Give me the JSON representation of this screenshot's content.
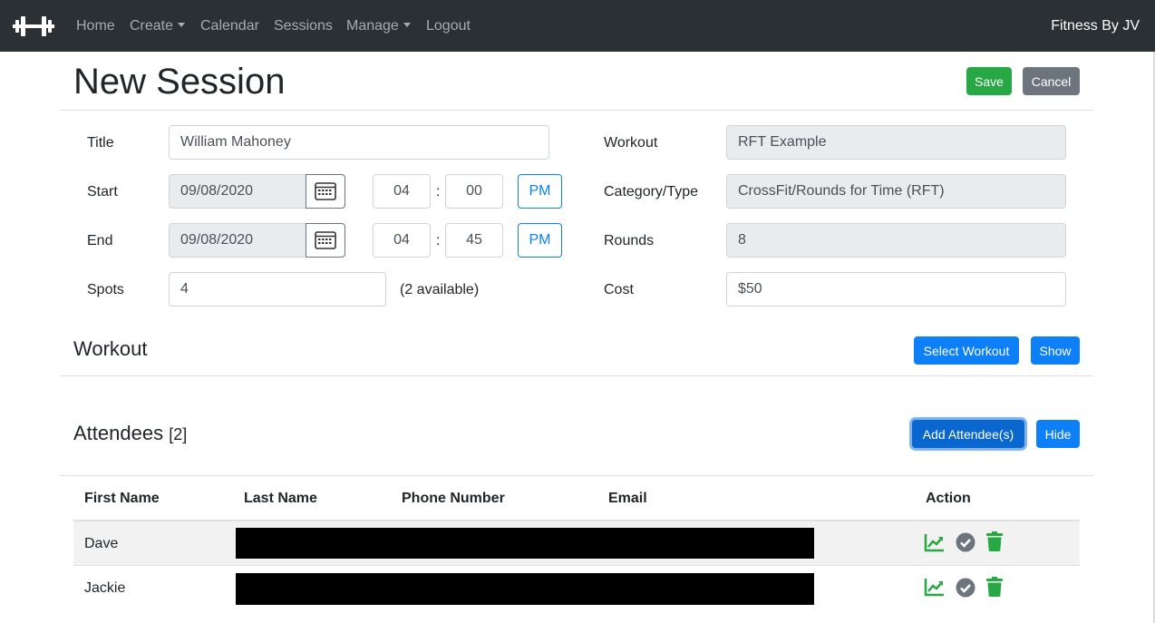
{
  "nav": {
    "links": [
      "Home",
      "Create",
      "Calendar",
      "Sessions",
      "Manage",
      "Logout"
    ],
    "brand": "Fitness By JV"
  },
  "page": {
    "title": "New Session",
    "save": "Save",
    "cancel": "Cancel"
  },
  "form": {
    "title_label": "Title",
    "title_value": "William Mahoney",
    "start_label": "Start",
    "start_date": "09/08/2020",
    "start_hour": "04",
    "start_min": "00",
    "start_ampm": "PM",
    "end_label": "End",
    "end_date": "09/08/2020",
    "end_hour": "04",
    "end_min": "45",
    "end_ampm": "PM",
    "time_sep": ":",
    "spots_label": "Spots",
    "spots_value": "4",
    "spots_available": "(2 available)",
    "workout_label": "Workout",
    "workout_value": "RFT Example",
    "category_label": "Category/Type",
    "category_value": "CrossFit/Rounds for Time (RFT)",
    "rounds_label": "Rounds",
    "rounds_value": "8",
    "cost_label": "Cost",
    "cost_value": "$50"
  },
  "workout_section": {
    "heading": "Workout",
    "select_button": "Select Workout",
    "show_button": "Show"
  },
  "attendees": {
    "heading": "Attendees",
    "count": "[2]",
    "add_button": "Add Attendee(s)",
    "hide_button": "Hide",
    "columns": [
      "First Name",
      "Last Name",
      "Phone Number",
      "Email",
      "Action"
    ],
    "rows": [
      {
        "first_name": "Dave"
      },
      {
        "first_name": "Jackie"
      }
    ]
  },
  "colors": {
    "navbar": "#2b3035",
    "success": "#28a745",
    "primary": "#0d7ff7",
    "secondary": "#6c757d",
    "action_icon": "#28a745",
    "check_icon": "#6c757d"
  },
  "icons": {
    "brand": "dumbbell-icon",
    "calendar": "calendar-icon",
    "progress": "chart-line-icon",
    "checkin": "check-circle-icon",
    "delete": "trash-icon"
  }
}
